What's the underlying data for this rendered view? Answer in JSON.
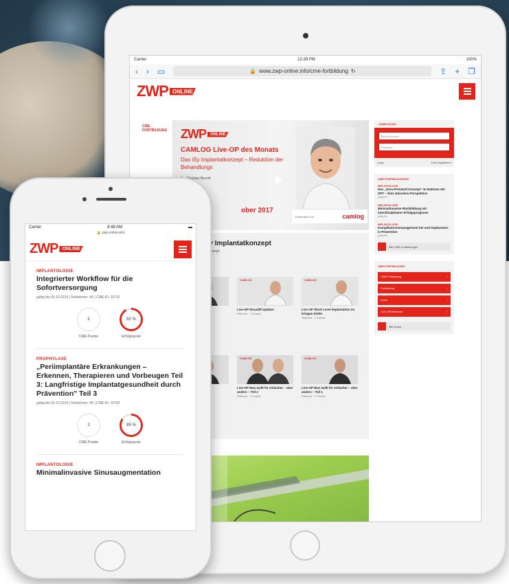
{
  "colors": {
    "brand_red": "#e2241b",
    "text_dark": "#222222"
  },
  "brand": {
    "logo_word": "ZWP",
    "logo_badge": "ONLINE"
  },
  "tablet": {
    "status": {
      "carrier": "Carrier",
      "time": "12:28 PM",
      "battery": "100%"
    },
    "url": "www.zwp-online.info/cme-fortbildung",
    "side_label": "CME-FORTBILDUNG",
    "hero": {
      "title": "CAMLOG Live-OP des Monats",
      "subtitle": "Das iSy Implantatkonzept – Reduktion der Behandlungs",
      "author": "Dr. Christian Berndt",
      "date": "ober 2017",
      "sponsor_label": "Präsentiert von",
      "sponsor_brand": "camlog"
    },
    "article": {
      "title": "as iSy Implantatkonzept",
      "subtitle": "Implantatkonzept"
    },
    "cards": [
      {
        "tag": "CAMLOG",
        "title": "",
        "meta": ""
      },
      {
        "tag": "CAMLOG",
        "title": "Live-OP Sinuslift Update!",
        "meta": "Referent · 1 Punkte"
      },
      {
        "tag": "CAMLOG",
        "title": "Live-OP Short Level Implantation im bringen Kiefer",
        "meta": "Referent · 1 Punkte"
      },
      {
        "tag": "CAMLOG",
        "title": "",
        "meta": ""
      },
      {
        "tag": "CAMLOG",
        "title": "Live-OP Was wollt ihr einfacher – aber anders – Teil 2",
        "meta": "Referent · 1 Punkte"
      },
      {
        "tag": "CAMLOG",
        "title": "Live-OP Was wollt ihr einfacher – aber anders – Teil 1",
        "meta": "Referent · 1 Punkte"
      }
    ],
    "login": {
      "head": "ANMELDUNG",
      "username_placeholder": "Benutzername",
      "password_placeholder": "Passwort",
      "submit": "Login",
      "register": "Jetzt registrieren"
    },
    "latest": {
      "head": "CME-FORTBILDUNGEN",
      "items": [
        {
          "tag": "IMPLANTOLOGIE",
          "title": "Das „Gera-Protokoll Konzept“ im Rahmen der OPT – Eine Zwischen-Perspektive",
          "meta": "gültig bis"
        },
        {
          "tag": "IMPLANTOLOGIE",
          "title": "Minimalinvasive Rückbildung mit interdisziplinärer Erfolgsprognose",
          "meta": "gültig bis"
        },
        {
          "tag": "IMPLANTOLOGIE",
          "title": "Komplikationsmanagement bei und Implantaten in Prävention",
          "meta": "gültig bis"
        }
      ],
      "all_button": "Alle CME-Fortbildungen"
    },
    "categories": {
      "head": "CME-FORTBILDUNG",
      "rows": [
        "CME-Fortbildung",
        "Fortbildung",
        "Kurse",
        "Live-OP/Webinare"
      ],
      "all_button": "Alle Kurse"
    }
  },
  "phone": {
    "status": {
      "carrier": "Carrier",
      "time": "8:48 AM"
    },
    "url": "zwp-online.info",
    "articles": [
      {
        "tag": "IMPLANTOLOGIE",
        "title": "Integrierter Workflow für die Sofortversorgung",
        "meta": "gültig bis 03.10.2019 | Teilnehmer: 46 | CME-ID: 10712",
        "points": "2",
        "points_label": "CME-Punkte",
        "success": "92 %",
        "success_value": 92,
        "success_label": "Erfolgsquote"
      },
      {
        "tag": "PROPHYLAXE",
        "title": "„Periimplantäre Erkrankungen – Erkennen, Therapieren und Vorbeugen Teil 3: Langfristige Implantatgesundheit durch Prävention\" Teil 3",
        "meta": "gültig bis 03.10.2019 | Teilnehmer: 45 | CME-ID: 10700",
        "points": "2",
        "points_label": "CME-Punkte",
        "success": "85 %",
        "success_value": 85,
        "success_label": "Erfolgsquote"
      },
      {
        "tag": "IMPLANTOLOGIE",
        "title": "Minimalinvasive Sinusaugmentation",
        "meta": ""
      }
    ]
  }
}
